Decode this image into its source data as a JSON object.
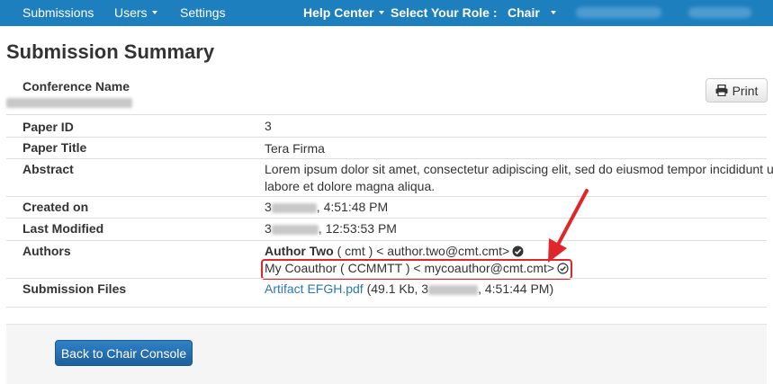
{
  "navbar": {
    "submissions": "Submissions",
    "users": "Users",
    "settings": "Settings",
    "help_center": "Help Center",
    "select_role": "Select Your Role :",
    "role": "Chair"
  },
  "page_title": "Submission Summary",
  "print_label": "Print",
  "rows": {
    "conference_name": {
      "label": "Conference Name",
      "value": ""
    },
    "paper_id": {
      "label": "Paper ID",
      "value": "3"
    },
    "paper_title": {
      "label": "Paper Title",
      "value": "Tera Firma"
    },
    "abstract": {
      "label": "Abstract",
      "value_line1": "Lorem ipsum dolor sit amet, consectetur adipiscing elit, sed do eiusmod tempor incididunt ut",
      "value_line2": "labore et dolore magna aliqua."
    },
    "created_on": {
      "label": "Created on",
      "prefix": "3",
      "time": ", 4:51:48 PM"
    },
    "last_modified": {
      "label": "Last Modified",
      "prefix": "3",
      "time": ", 12:53:53 PM"
    },
    "authors": {
      "label": "Authors",
      "author1_name": "Author Two",
      "author1_rest": " ( cmt ) < author.two@cmt.cmt>",
      "author2": "My Coauthor ( CCMMTT ) < mycoauthor@cmt.cmt>"
    },
    "submission_files": {
      "label": "Submission Files",
      "file_name": "Artifact EFGH.pdf",
      "file_info_prefix": " (49.1 Kb, 3",
      "file_info_time": ", 4:51:44 PM)"
    }
  },
  "back_button": "Back to Chair Console",
  "colors": {
    "navbar": "#1e7fbf",
    "link": "#2a77b4",
    "highlight": "#e0262a",
    "button": "#1d5f9e"
  }
}
